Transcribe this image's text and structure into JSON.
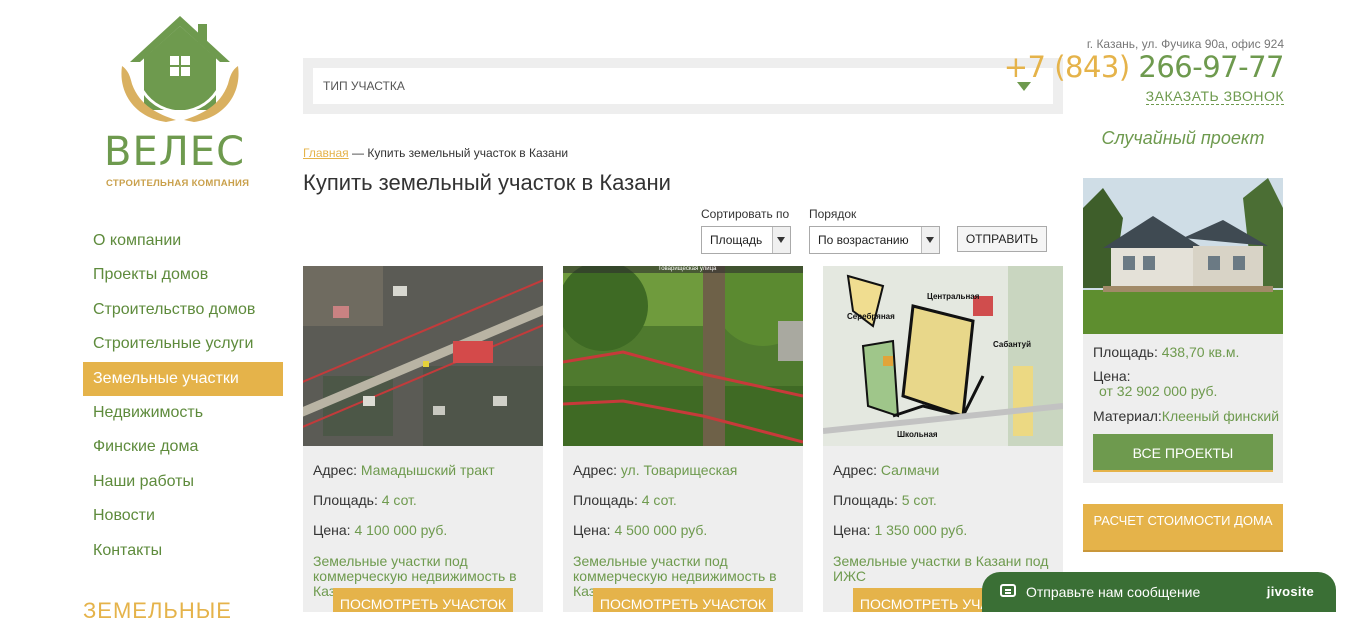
{
  "logo": {
    "brand": "ВЕЛЕС",
    "subtitle": "СТРОИТЕЛЬНАЯ КОМПАНИЯ"
  },
  "nav": {
    "items": [
      {
        "label": "О компании"
      },
      {
        "label": "Проекты домов"
      },
      {
        "label": "Строительство домов"
      },
      {
        "label": "Строительные услуги"
      },
      {
        "label": "Земельные участки",
        "active": true
      },
      {
        "label": "Недвижимость"
      },
      {
        "label": "Финские дома"
      },
      {
        "label": "Наши работы"
      },
      {
        "label": "Новости"
      },
      {
        "label": "Контакты"
      }
    ],
    "section_heading": "ЗЕМЕЛЬНЫЕ"
  },
  "filter": {
    "type_placeholder": "ТИП УЧАСТКА"
  },
  "breadcrumb": {
    "home": "Главная",
    "separator": "—",
    "current": "Купить земельный участок в Казани"
  },
  "page_title": "Купить земельный участок в Казани",
  "sort": {
    "sort_by_label": "Сортировать по",
    "sort_by_value": "Площадь",
    "order_label": "Порядок",
    "order_value": "По возрастанию",
    "submit_label": "ОТПРАВИТЬ"
  },
  "cards": [
    {
      "address_label": "Адрес:",
      "address": "Мамадышский тракт",
      "area_label": "Площадь:",
      "area": "4 сот.",
      "price_label": "Цена:",
      "price": "4 100 000 руб.",
      "category": "Земельные участки под коммерческую недвижимость в Казани",
      "button": "ПОСМОТРЕТЬ УЧАСТОК",
      "image": "satellite-map"
    },
    {
      "address_label": "Адрес:",
      "address": "ул. Товарищеская",
      "area_label": "Площадь:",
      "area": "4 сот.",
      "price_label": "Цена:",
      "price": "4 500 000 руб.",
      "category": "Земельные участки под коммерческую недвижимость в Казани",
      "button": "ПОСМОТРЕТЬ УЧАСТОК",
      "image": "street-view",
      "image_street_label": "Товарищеская улица"
    },
    {
      "address_label": "Адрес:",
      "address": "Салмачи",
      "area_label": "Площадь:",
      "area": "5 сот.",
      "price_label": "Цена:",
      "price": "1 350 000 руб.",
      "category": "Земельные участки в Казани под ИЖС",
      "button": "ПОСМОТРЕТЬ УЧАСТОК",
      "image": "plan-map",
      "image_labels": [
        "Центральная",
        "Серебряная",
        "Сабантуй",
        "Школьная"
      ]
    }
  ],
  "contact": {
    "address": "г. Казань, ул. Фучика 90а, офис 924",
    "phone_code": "+7 (843)",
    "phone_number": "266-97-77",
    "callback": "ЗАКАЗАТЬ ЗВОНОК"
  },
  "random_project": {
    "title": "Случайный проект",
    "area_label": "Площадь:",
    "area": "438,70 кв.м.",
    "price_label": "Цена:",
    "price": "от 32 902 000 руб.",
    "material_label": "Материал:",
    "material": "Клееный финский",
    "all_projects": "ВСЕ ПРОЕКТЫ"
  },
  "calc_button": "РАСЧЕТ СТОИМОСТИ ДОМА",
  "chat": {
    "text": "Отправьте нам сообщение",
    "brand": "jivosite"
  },
  "colors": {
    "green": "#6e9a4e",
    "gold": "#e5b34a",
    "panel": "#eeeeee",
    "chat": "#3a6f35"
  }
}
